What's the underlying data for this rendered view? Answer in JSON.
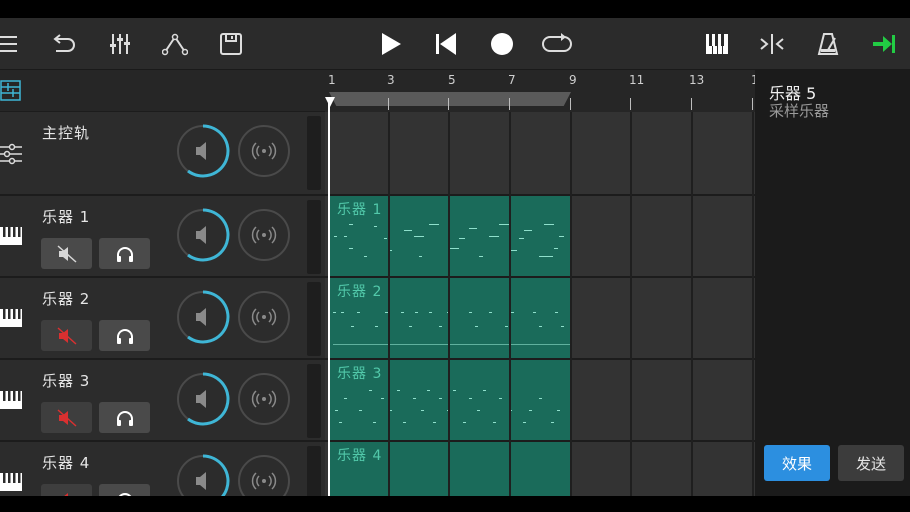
{
  "toolbar": {
    "left_icons": [
      "menu-icon",
      "undo-icon",
      "mixer-icon",
      "automation-icon",
      "save-icon"
    ],
    "center_icons": [
      "play-icon",
      "rewind-icon",
      "record-icon",
      "loop-icon"
    ],
    "right_icons": [
      "piano-icon",
      "snap-icon",
      "metronome-icon",
      "export-icon"
    ],
    "accent_color": "#22cc44"
  },
  "ruler": {
    "bar_numbers": [
      "1",
      "3",
      "5",
      "7",
      "9",
      "11",
      "13",
      "1"
    ]
  },
  "tracks": [
    {
      "name": "主控轨",
      "type": "master"
    },
    {
      "name": "乐器 1",
      "muted": false,
      "clip_label": "乐器 1"
    },
    {
      "name": "乐器 2",
      "muted": true,
      "clip_label": "乐器 2"
    },
    {
      "name": "乐器 3",
      "muted": true,
      "clip_label": "乐器 3"
    },
    {
      "name": "乐器 4",
      "muted": true,
      "clip_label": "乐器 4"
    }
  ],
  "right_panel": {
    "title": "乐器 5",
    "subtitle": "采样乐器",
    "effects_button": "效果",
    "send_button": "发送"
  },
  "colors": {
    "clip_fill": "#1a6b5a",
    "clip_label": "#52c9aa",
    "knob_ring": "#3fb6d6",
    "mute_red": "#d93030",
    "effects_button_bg": "#2c8fe0"
  }
}
